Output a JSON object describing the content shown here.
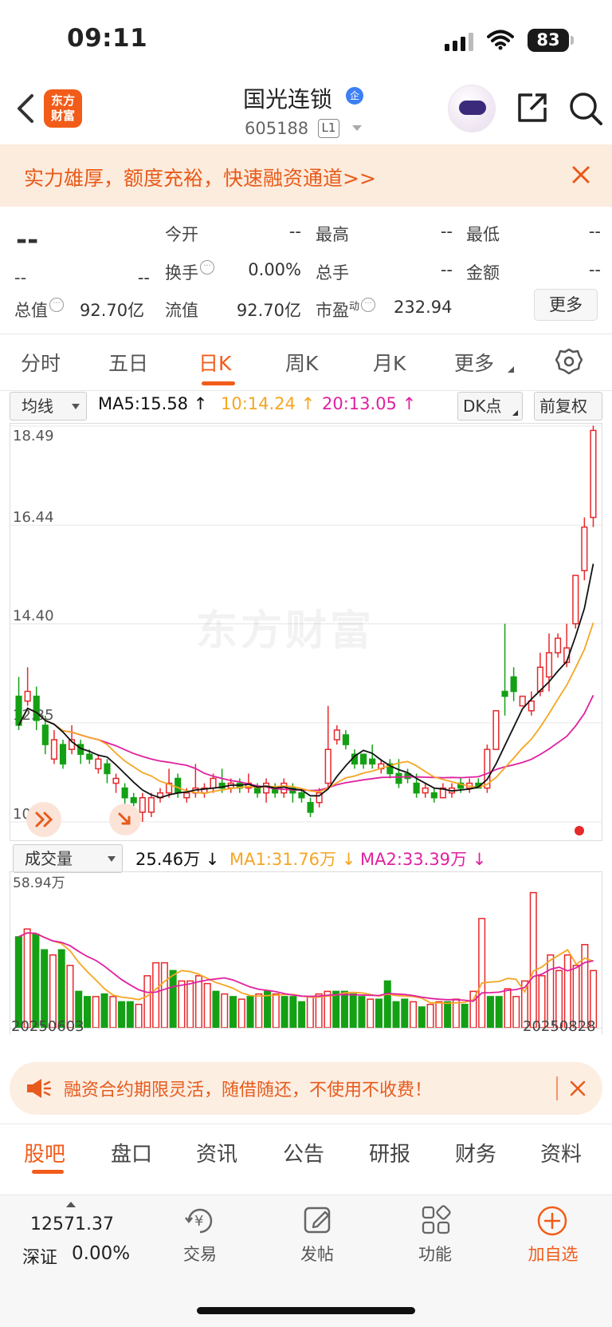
{
  "status_bar": {
    "time": "09:11",
    "battery": "83"
  },
  "header": {
    "logo_text": "东方财富",
    "stock_name": "国光连锁",
    "badge": "企",
    "stock_code": "605188",
    "level": "L1"
  },
  "promo": {
    "text": "实力雄厚，额度充裕，快速融资通道>>"
  },
  "quote": {
    "price": "--",
    "change": "--",
    "change_pct": "--",
    "open_label": "今开",
    "open": "--",
    "high_label": "最高",
    "high": "--",
    "low_label": "最低",
    "low": "--",
    "turnover_label": "换手",
    "turnover": "0.00%",
    "volume_label": "总手",
    "volume": "--",
    "amount_label": "金额",
    "amount": "--",
    "mktcap_label": "总值",
    "mktcap": "92.70亿",
    "float_label": "流值",
    "float": "92.70亿",
    "pe_label": "市盈",
    "pe_sup": "动",
    "pe": "232.94",
    "more_button": "更多"
  },
  "period_tabs": [
    "分时",
    "五日",
    "日K",
    "周K",
    "月K",
    "更多"
  ],
  "active_period": "日K",
  "chart_controls": {
    "indicator_select": "均线",
    "ma5": "MA5:15.58",
    "ma10": "10:14.24",
    "ma20": "20:13.05",
    "dk_button": "DK点",
    "adjust_button": "前复权",
    "volume_select": "成交量",
    "vol_value": "25.46万",
    "vol_ma1": "MA1:31.76万",
    "vol_ma2": "MA2:33.39万"
  },
  "colors": {
    "up": "#e8282b",
    "down": "#14a014",
    "accent": "#f25c19",
    "ma5": "#111111",
    "ma10": "#f5a623",
    "ma20": "#e020a0"
  },
  "watermark": "东方财富",
  "chart_data": [
    {
      "type": "candlestick",
      "title": "",
      "y_ticks": [
        "18.49",
        "16.44",
        "14.40",
        "12.35",
        "10.30"
      ],
      "ylim": [
        10.3,
        18.49
      ],
      "grid": true,
      "ohlc": [
        [
          12.9,
          12.3,
          13.3,
          12.2
        ],
        [
          12.8,
          13.0,
          13.5,
          12.7
        ],
        [
          12.9,
          12.4,
          13.1,
          12.2
        ],
        [
          12.3,
          11.9,
          12.5,
          11.7
        ],
        [
          11.6,
          12.0,
          12.2,
          11.5
        ],
        [
          11.9,
          11.5,
          12.0,
          11.4
        ],
        [
          11.8,
          12.0,
          12.3,
          11.7
        ],
        [
          11.9,
          11.7,
          12.0,
          11.5
        ],
        [
          11.7,
          11.6,
          11.8,
          11.5
        ],
        [
          11.4,
          11.6,
          11.7,
          11.3
        ],
        [
          11.5,
          11.3,
          11.6,
          11.1
        ],
        [
          11.1,
          11.2,
          11.3,
          10.9
        ],
        [
          11.0,
          10.8,
          11.1,
          10.6
        ],
        [
          10.8,
          10.7,
          10.9,
          10.5
        ],
        [
          10.5,
          10.8,
          10.9,
          10.3
        ],
        [
          10.5,
          10.8,
          10.9,
          10.4
        ],
        [
          10.8,
          10.9,
          11.0,
          10.7
        ],
        [
          10.9,
          11.1,
          11.4,
          10.8
        ],
        [
          11.2,
          10.9,
          11.3,
          10.8
        ],
        [
          10.8,
          10.9,
          11.0,
          10.7
        ],
        [
          10.9,
          11.0,
          11.5,
          10.8
        ],
        [
          10.9,
          11.0,
          11.1,
          10.8
        ],
        [
          11.0,
          11.2,
          11.3,
          10.9
        ],
        [
          11.1,
          11.0,
          11.4,
          10.9
        ],
        [
          11.0,
          11.1,
          11.2,
          10.9
        ],
        [
          11.1,
          11.0,
          11.2,
          10.9
        ],
        [
          11.0,
          11.1,
          11.3,
          10.9
        ],
        [
          11.0,
          10.9,
          11.1,
          10.8
        ],
        [
          10.9,
          11.1,
          11.2,
          10.7
        ],
        [
          11.0,
          10.9,
          11.1,
          10.8
        ],
        [
          10.9,
          11.1,
          11.2,
          10.8
        ],
        [
          11.0,
          10.9,
          11.1,
          10.7
        ],
        [
          10.9,
          10.8,
          11.0,
          10.7
        ],
        [
          10.7,
          10.5,
          10.8,
          10.4
        ],
        [
          10.7,
          10.9,
          11.0,
          10.6
        ],
        [
          11.1,
          11.8,
          12.7,
          11.0
        ],
        [
          12.0,
          12.2,
          12.3,
          11.9
        ],
        [
          12.1,
          11.9,
          12.2,
          11.8
        ],
        [
          11.7,
          11.5,
          11.8,
          11.4
        ],
        [
          11.7,
          11.5,
          11.6,
          11.4
        ],
        [
          11.6,
          11.5,
          11.9,
          11.4
        ],
        [
          11.4,
          11.5,
          11.6,
          11.3
        ],
        [
          11.5,
          11.3,
          11.6,
          11.2
        ],
        [
          11.3,
          11.1,
          11.6,
          11.0
        ],
        [
          11.3,
          11.2,
          11.4,
          11.1
        ],
        [
          11.1,
          10.9,
          11.3,
          10.8
        ],
        [
          10.9,
          11.0,
          11.1,
          10.8
        ],
        [
          10.9,
          10.8,
          11.0,
          10.7
        ],
        [
          10.8,
          11.0,
          11.1,
          10.8
        ],
        [
          10.9,
          11.0,
          11.1,
          10.8
        ],
        [
          11.1,
          11.0,
          11.2,
          10.9
        ],
        [
          11.0,
          11.1,
          11.2,
          10.9
        ],
        [
          11.1,
          11.0,
          11.2,
          11.0
        ],
        [
          11.0,
          11.8,
          11.9,
          10.9
        ],
        [
          11.8,
          12.6,
          12.6,
          11.8
        ],
        [
          13.0,
          12.9,
          14.4,
          12.5
        ],
        [
          13.3,
          13.0,
          13.5,
          12.8
        ],
        [
          12.7,
          12.9,
          12.9,
          12.7
        ],
        [
          12.6,
          12.8,
          13.0,
          12.5
        ],
        [
          13.0,
          13.5,
          13.8,
          12.9
        ],
        [
          13.3,
          13.8,
          14.2,
          13.0
        ],
        [
          13.8,
          14.1,
          14.2,
          13.7
        ],
        [
          13.6,
          13.9,
          14.4,
          13.5
        ],
        [
          14.4,
          15.4,
          15.4,
          14.3
        ],
        [
          15.5,
          16.4,
          16.6,
          15.3
        ],
        [
          16.6,
          18.4,
          18.5,
          16.4
        ]
      ]
    },
    {
      "type": "bar",
      "title": "",
      "ylabel": "58.94万",
      "xlabel_left": "20250603",
      "xlabel_right": "20250828",
      "ylim": [
        0,
        58.94
      ],
      "series": [
        {
          "name": "成交量",
          "values": [
            35,
            38,
            36,
            30,
            28,
            30,
            24,
            14,
            12,
            12,
            13,
            12,
            10,
            10,
            9,
            20,
            25,
            25,
            22,
            18,
            18,
            20,
            17,
            14,
            13,
            12,
            11,
            12,
            13,
            14,
            13,
            12,
            12,
            10,
            12,
            13,
            14,
            14,
            14,
            13,
            12,
            11,
            11,
            18,
            10,
            11,
            10,
            8,
            9,
            10,
            10,
            11,
            9,
            14,
            42,
            12,
            12,
            15,
            12,
            18,
            52,
            20,
            28,
            22,
            28,
            24,
            32,
            22
          ]
        },
        {
          "name": "MA1",
          "values": [
            31.76
          ]
        },
        {
          "name": "MA2",
          "values": [
            33.39
          ]
        }
      ]
    }
  ],
  "bottom_ad": {
    "text": "融资合约期限灵活，随借随还，不使用不收费！"
  },
  "content_tabs": [
    "股吧",
    "盘口",
    "资讯",
    "公告",
    "研报",
    "财务",
    "资料"
  ],
  "active_content_tab": "股吧",
  "bottom_nav": {
    "index_value": "12571.37",
    "index_name": "深证",
    "index_change": "0.00%",
    "items": [
      "交易",
      "发帖",
      "功能",
      "加自选"
    ]
  }
}
